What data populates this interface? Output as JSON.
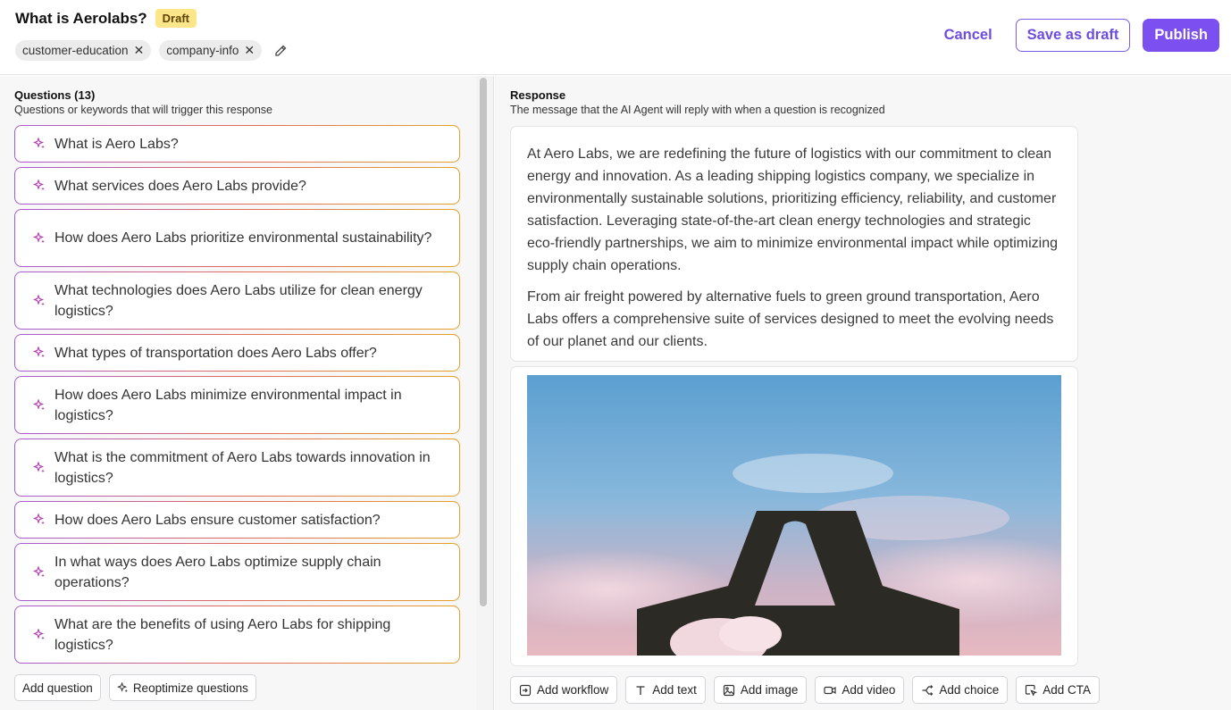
{
  "header": {
    "title": "What is Aerolabs?",
    "status_badge": "Draft",
    "tags": [
      {
        "label": "customer-education"
      },
      {
        "label": "company-info"
      }
    ],
    "cancel_label": "Cancel",
    "save_draft_label": "Save as draft",
    "publish_label": "Publish"
  },
  "questions": {
    "title": "Questions (13)",
    "subtitle": "Questions or keywords that will trigger this response",
    "items": [
      {
        "text": "What is Aero Labs?"
      },
      {
        "text": "What services does Aero Labs provide?"
      },
      {
        "text": "How does Aero Labs prioritize environmental sustainability?"
      },
      {
        "text": "What technologies does Aero Labs utilize for clean energy logistics?"
      },
      {
        "text": "What types of transportation does Aero Labs offer?"
      },
      {
        "text": "How does Aero Labs minimize environmental impact in logistics?"
      },
      {
        "text": "What is the commitment of Aero Labs towards innovation in logistics?"
      },
      {
        "text": "How does Aero Labs ensure customer satisfaction?"
      },
      {
        "text": "In what ways does Aero Labs optimize supply chain operations?"
      },
      {
        "text": "What are the benefits of using Aero Labs for shipping logistics?"
      }
    ],
    "add_question_label": "Add question",
    "reoptimize_label": "Reoptimize questions"
  },
  "response": {
    "title": "Response",
    "subtitle": "The message that the AI Agent will reply with when a question is recognized",
    "paragraphs": [
      "At Aero Labs, we are redefining the future of logistics with our commitment to clean energy and innovation. As a leading shipping logistics company, we specialize in environmentally sustainable solutions, prioritizing efficiency, reliability, and customer satisfaction. Leveraging state-of-the-art clean energy technologies and strategic eco-friendly partnerships, we aim to minimize environmental impact while optimizing supply chain operations.",
      "From air freight powered by alternative fuels to green ground transportation, Aero Labs offers a comprehensive suite of services designed to meet the evolving needs of our planet and our clients."
    ],
    "buttons": {
      "add_workflow": "Add workflow",
      "add_text": "Add text",
      "add_image": "Add image",
      "add_video": "Add video",
      "add_choice": "Add choice",
      "add_cta": "Add CTA"
    }
  },
  "colors": {
    "accent": "#7c4ff0",
    "badge_bg": "#fde68a"
  }
}
